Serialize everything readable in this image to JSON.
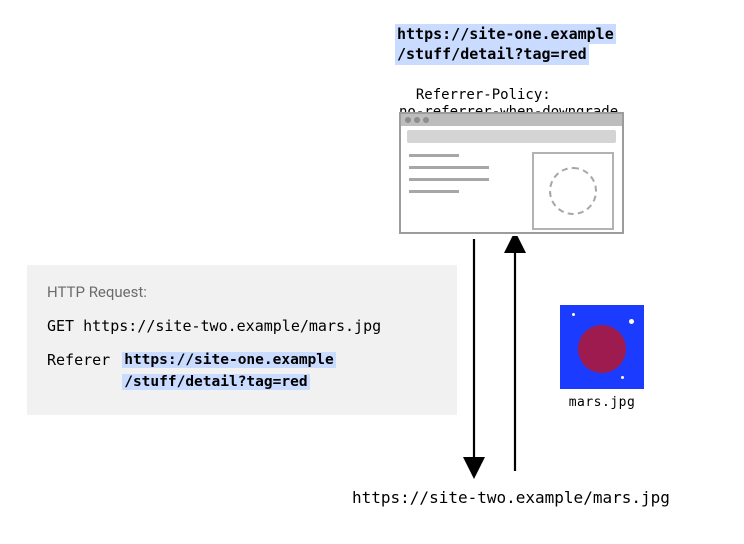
{
  "top_url": {
    "line1": "https://site-one.example",
    "line2": "/stuff/detail?tag=red"
  },
  "policy": {
    "label": "Referrer-Policy:",
    "value": "no-referrer-when-downgrade"
  },
  "mars": {
    "caption": "mars.jpg"
  },
  "bottom_url": "https://site-two.example/mars.jpg",
  "panel": {
    "title": "HTTP Request:",
    "get_line": "GET https://site-two.example/mars.jpg",
    "referer_label": "Referer",
    "referer_line1": "https://site-one.example",
    "referer_line2": "/stuff/detail?tag=red"
  }
}
